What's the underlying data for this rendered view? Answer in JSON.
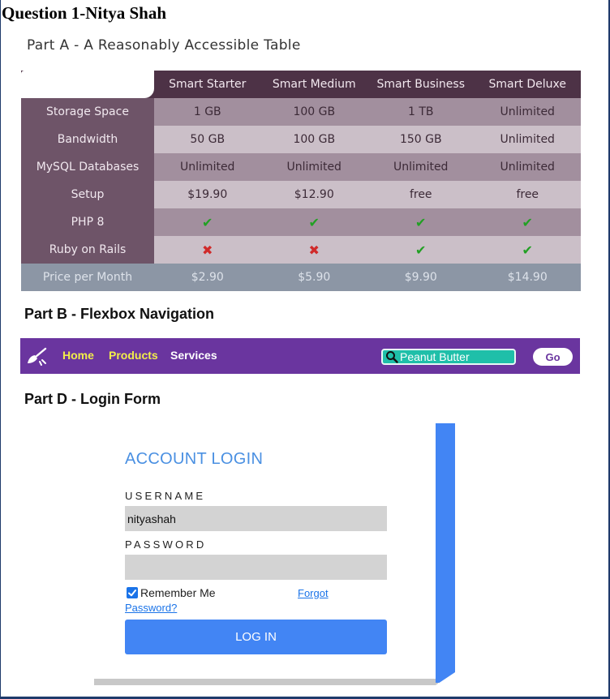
{
  "page_title": "Question 1-Nitya Shah",
  "part_a": {
    "title": "Part A - A Reasonably Accessible Table",
    "columns": [
      "Smart Starter",
      "Smart Medium",
      "Smart Business",
      "Smart Deluxe"
    ],
    "rows": [
      {
        "label": "Storage Space",
        "cells": [
          "1 GB",
          "100 GB",
          "1 TB",
          "Unlimited"
        ]
      },
      {
        "label": "Bandwidth",
        "cells": [
          "50 GB",
          "100 GB",
          "150 GB",
          "Unlimited"
        ]
      },
      {
        "label": "MySQL Databases",
        "cells": [
          "Unlimited",
          "Unlimited",
          "Unlimited",
          "Unlimited"
        ]
      },
      {
        "label": "Setup",
        "cells": [
          "$19.90",
          "$12.90",
          "free",
          "free"
        ]
      },
      {
        "label": "PHP 8",
        "cells": [
          "✔",
          "✔",
          "✔",
          "✔"
        ]
      },
      {
        "label": "Ruby on Rails",
        "cells": [
          "✖",
          "✖",
          "✔",
          "✔"
        ]
      }
    ],
    "footer": {
      "label": "Price per Month",
      "cells": [
        "$2.90",
        "$5.90",
        "$9.90",
        "$14.90"
      ]
    }
  },
  "part_b": {
    "title": "Part B - Flexbox Navigation",
    "nav": {
      "logo_icon": "broom-icon",
      "links": [
        "Home",
        "Products",
        "Services"
      ],
      "search_value": "Peanut Butter",
      "go_label": "Go"
    }
  },
  "part_d": {
    "title": "Part D - Login Form",
    "login": {
      "heading": "ACCOUNT LOGIN",
      "username_label": "USERNAME",
      "username_value": "nityashah",
      "password_label": "PASSWORD",
      "password_value": "",
      "remember_label": "Remember Me",
      "remember_checked": true,
      "forgot_label": "Forgot",
      "password_link_label": "Password?",
      "submit_label": "LOG IN"
    }
  },
  "colors": {
    "table_header": "#4d3246",
    "table_row_label": "#6e5468",
    "table_cell_dark": "#a28f9e",
    "table_cell_light": "#cbbfc8",
    "table_footer": "#8c96a5",
    "check": "#22a024",
    "cross": "#d02a2a",
    "nav_bg": "#6a359f",
    "nav_link_active": "#f2ee4a",
    "search_bg": "#1fbfa9",
    "login_accent": "#4285f4"
  }
}
